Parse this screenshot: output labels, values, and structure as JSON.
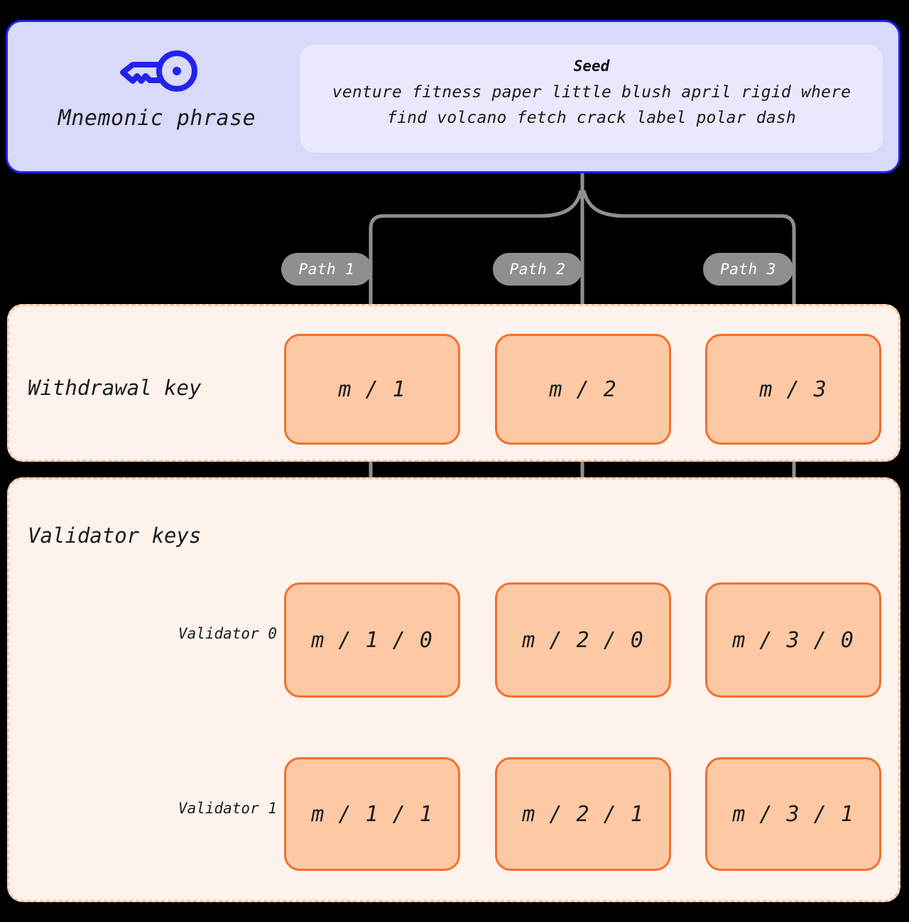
{
  "mnemonic": {
    "icon": "key-icon",
    "label": "Mnemonic phrase",
    "seed_title": "Seed",
    "seed_line_1": "venture fitness paper little blush april rigid where",
    "seed_line_2": "find volcano fetch crack label polar dash"
  },
  "paths": [
    {
      "label": "Path 1"
    },
    {
      "label": "Path 2"
    },
    {
      "label": "Path 3"
    }
  ],
  "withdrawal_section": {
    "title": "Withdrawal key",
    "keys": [
      {
        "label": "m / 1"
      },
      {
        "label": "m / 2"
      },
      {
        "label": "m / 3"
      }
    ]
  },
  "validator_section": {
    "title": "Validator keys",
    "rows": [
      {
        "row_label": "Validator 0",
        "keys": [
          {
            "label": "m / 1 / 0"
          },
          {
            "label": "m / 2 / 0"
          },
          {
            "label": "m / 3 / 0"
          }
        ]
      },
      {
        "row_label": "Validator 1",
        "keys": [
          {
            "label": "m / 1 / 1"
          },
          {
            "label": "m / 2 / 1"
          },
          {
            "label": "m / 3 / 1"
          }
        ]
      }
    ]
  },
  "colors": {
    "background": "#000000",
    "mnemonic_fill": "#d9d9fa",
    "mnemonic_border": "#2222ee",
    "seed_fill": "#e9e9fd",
    "key_icon": "#2222ee",
    "section_fill": "#fdf2ec",
    "section_border": "#fbc5a0",
    "keybox_fill": "#fcc9a4",
    "keybox_border": "#f2702a",
    "connector": "#8f8f8f",
    "pill_fill": "#8f8f8f",
    "pill_text": "#ffffff",
    "text": "#1c1c1c"
  }
}
